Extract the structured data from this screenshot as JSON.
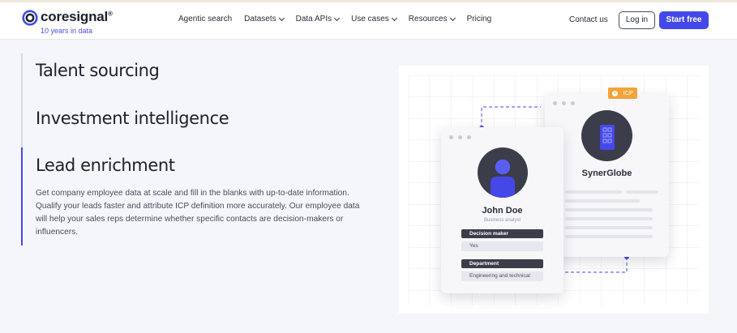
{
  "nav": {
    "logo_text": "coresignal",
    "logo_reg": "®",
    "logo_sub": "10 years in data",
    "items": [
      {
        "label": "Agentic search",
        "dropdown": false
      },
      {
        "label": "Datasets",
        "dropdown": true
      },
      {
        "label": "Data APIs",
        "dropdown": true
      },
      {
        "label": "Use cases",
        "dropdown": true
      },
      {
        "label": "Resources",
        "dropdown": true
      },
      {
        "label": "Pricing",
        "dropdown": false
      }
    ],
    "contact_label": "Contact us",
    "login_label": "Log in",
    "start_label": "Start free"
  },
  "tabs": [
    {
      "title": "Talent sourcing",
      "active": false
    },
    {
      "title": "Investment intelligence",
      "active": false
    },
    {
      "title": "Lead enrichment",
      "active": true,
      "description": "Get company employee data at scale and fill in the blanks with up-to-date information. Qualify your leads faster and attribute ICP definition more accurately. Our employee data will help your sales reps determine whether specific contacts are decision-makers or influencers."
    }
  ],
  "illustration": {
    "icp_badge": "ICP",
    "company_name": "SynerGlobe",
    "person_name": "John Doe",
    "person_role": "Business analyst",
    "fields": [
      {
        "label": "Decision maker",
        "value": "Yes"
      },
      {
        "label": "Department",
        "value": "Engineering and technical"
      }
    ]
  },
  "colors": {
    "accent": "#4548e9",
    "badge": "#f2a33a",
    "dark": "#3b3d4a",
    "page_bg": "#f5f6fa"
  }
}
